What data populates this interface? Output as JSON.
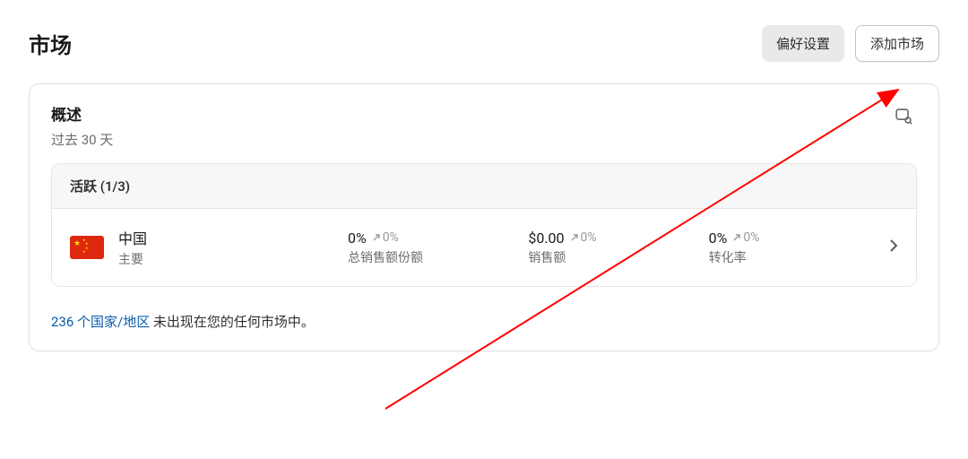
{
  "header": {
    "title": "市场",
    "preferences_label": "偏好设置",
    "add_market_label": "添加市场"
  },
  "overview": {
    "title": "概述",
    "subtitle": "过去 30 天"
  },
  "active_section": {
    "header": "活跃 (1/3)"
  },
  "row": {
    "country_name": "中国",
    "country_tag": "主要",
    "metrics": [
      {
        "value": "0%",
        "trend": "0%",
        "label": "总销售额份额"
      },
      {
        "value": "$0.00",
        "trend": "0%",
        "label": "销售额"
      },
      {
        "value": "0%",
        "trend": "0%",
        "label": "转化率"
      }
    ]
  },
  "footer": {
    "link": "236 个国家/地区",
    "suffix": " 未出现在您的任何市场中。"
  },
  "icons": {
    "search": "search-icon",
    "chevron_right": "chevron-right-icon",
    "trend_up": "arrow-up-right-icon"
  }
}
